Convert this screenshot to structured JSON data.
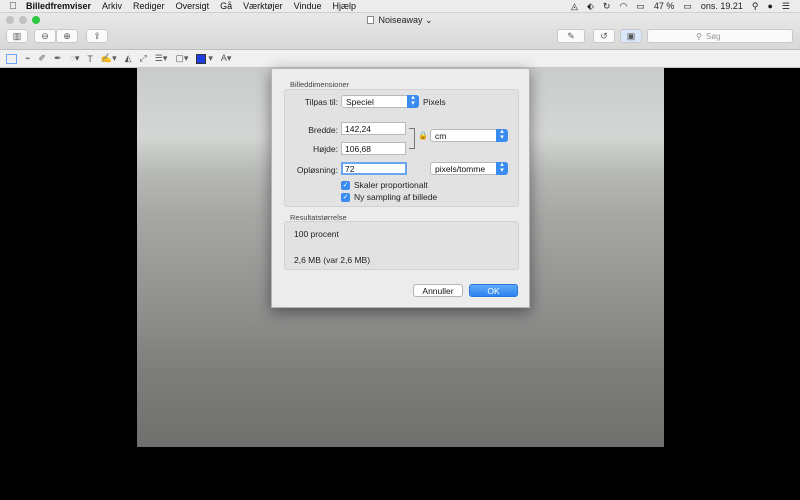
{
  "menubar": {
    "app_name": "Billedfremviser",
    "items": [
      "Arkiv",
      "Rediger",
      "Oversigt",
      "Gå",
      "Værktøjer",
      "Vindue",
      "Hjælp"
    ],
    "battery": "47 %",
    "clock": "ons. 19.21"
  },
  "window": {
    "title": "Noiseaway",
    "search_placeholder": "Søg"
  },
  "dialog": {
    "section_dimensions": "Billeddimensioner",
    "fit_label": "Tilpas til:",
    "fit_value": "Speciel",
    "fit_unit": "Pixels",
    "width_label": "Bredde:",
    "width_value": "142,24",
    "height_label": "Højde:",
    "height_value": "106,68",
    "unit_value": "cm",
    "resolution_label": "Opløsning:",
    "resolution_value": "72",
    "resolution_unit": "pixels/tomme",
    "scale_proportional": "Skaler proportionalt",
    "resample": "Ny sampling af billede",
    "section_result": "Resultatstørrelse",
    "result_percent": "100 procent",
    "result_size": "2,6 MB (var 2,6 MB)",
    "cancel_label": "Annuller",
    "ok_label": "OK"
  },
  "colors": {
    "accent": "#3b8cf0",
    "markup_color": "#1f3ee0",
    "zoom_button_green": "#2cc840"
  }
}
